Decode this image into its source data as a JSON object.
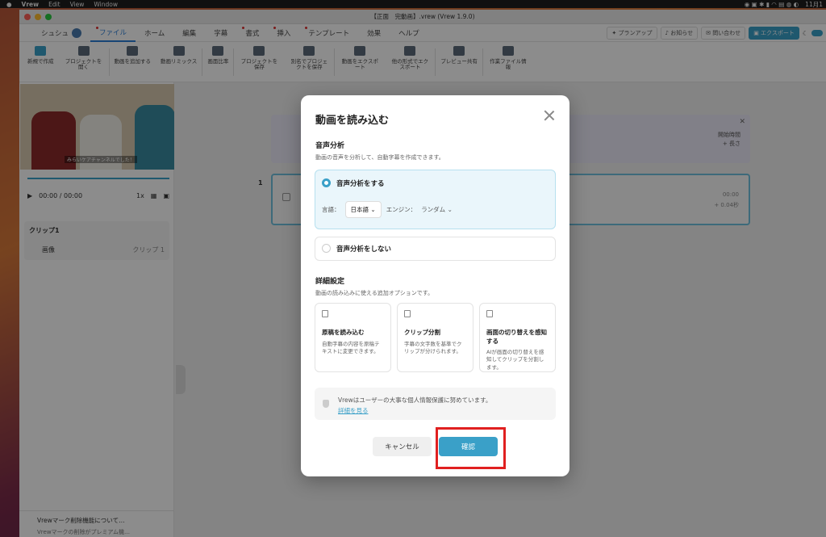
{
  "menubar": {
    "app": "Vrew",
    "items": [
      "Edit",
      "View",
      "Window"
    ],
    "clock": "11月1"
  },
  "window": {
    "title": "【正面　完動画】.vrew (Vrew 1.9.0)"
  },
  "tabs": {
    "user": "シュシュ",
    "items": [
      "ファイル",
      "ホーム",
      "編集",
      "字幕",
      "書式",
      "挿入",
      "テンプレート",
      "効果",
      "ヘルプ"
    ],
    "active": "ファイル"
  },
  "topright": {
    "plan": "プランアップ",
    "notice": "お知らせ",
    "contact": "問い合わせ",
    "export": "エクスポート"
  },
  "toolbar": [
    "新規で作成",
    "プロジェクトを開く",
    "動画を追加する",
    "動画リミックス",
    "画面比率",
    "プロジェクトを保存",
    "別名でプロジェクトを保存",
    "動画をエクスポート",
    "他の形式でエクスポート",
    "プレビュー共有",
    "作業ファイル情報"
  ],
  "left": {
    "subtitle": "みらいケアチャンネルでした！",
    "time": "00:00 / 00:00",
    "speed": "1x",
    "clip_title": "クリップ1",
    "clip_item": "画像",
    "clip_item_right": "クリップ 1",
    "note_title": "Vrewマーク削除機能について…",
    "note_sub": "Vrewマークの削除がプレミアム機…"
  },
  "editor": {
    "row_number": "1",
    "start_label": "開始時間",
    "length_label": "+ 長さ",
    "time": "00:00",
    "dur": "+ 0.04秒"
  },
  "modal": {
    "title": "動画を読み込む",
    "audio_heading": "音声分析",
    "audio_desc": "動画の音声を分析して、自動字幕を作成できます。",
    "opt_on": "音声分析をする",
    "lang_label": "言語：",
    "lang_value": "日本語",
    "engine_label": "エンジン：",
    "engine_value": "ランダム",
    "opt_off": "音声分析をしない",
    "detail_heading": "詳細設定",
    "detail_desc": "動画の読み込みに使える追加オプションです。",
    "cards": [
      {
        "title": "原稿を読み込む",
        "desc": "自動字幕の内容を原稿テキストに変更できます。"
      },
      {
        "title": "クリップ分割",
        "desc": "字幕の文字数を基準でクリップが分けられます。"
      },
      {
        "title": "画面の切り替えを感知する",
        "desc": "AIが画面の切り替えを感知してクリップを分割します。"
      }
    ],
    "privacy_text": "Vrewはユーザーの大事な個人情報保護に努めています。",
    "privacy_link": "詳細を見る",
    "cancel": "キャンセル",
    "confirm": "確認"
  }
}
